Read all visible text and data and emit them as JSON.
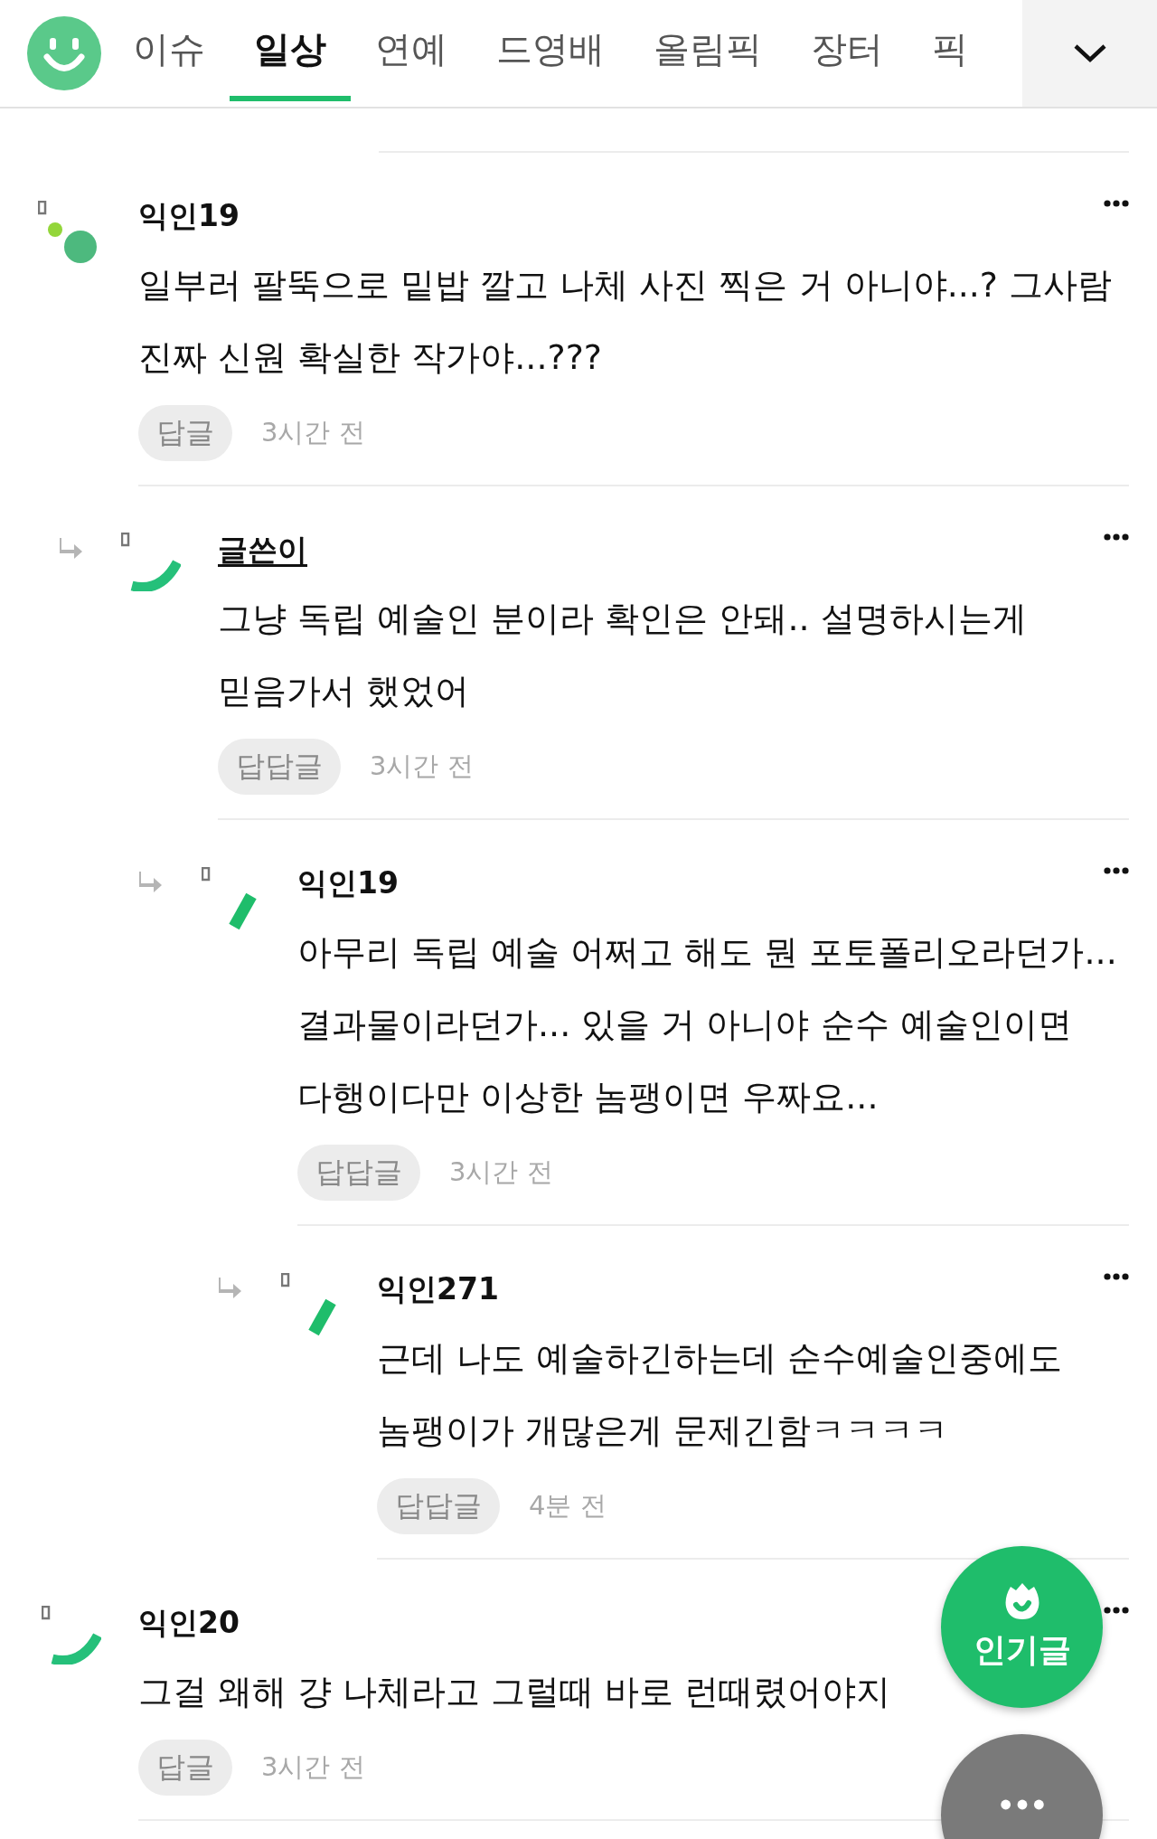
{
  "tabs": [
    {
      "label": "이슈",
      "selected": false
    },
    {
      "label": "일상",
      "selected": true
    },
    {
      "label": "연예",
      "selected": false
    },
    {
      "label": "드영배",
      "selected": false
    },
    {
      "label": "올림픽",
      "selected": false
    },
    {
      "label": "장터",
      "selected": false
    },
    {
      "label": "픽",
      "selected": false
    }
  ],
  "comments": [
    {
      "author": "익인19",
      "is_writer": false,
      "kind": "dots",
      "text": "일부러 팔뚝으로 밑밥 깔고 나체 사진 찍은 거 아니야...? 그사람 진짜 신원 확실한 작가야...???",
      "reply_label": "답글",
      "time": "3시간 전",
      "children": [
        {
          "author": "글쓴이",
          "is_writer": true,
          "kind": "arc",
          "text": "그냥 독립 예술인 분이라 확인은 안돼.. 설명하시는게 믿음가서 했었어",
          "reply_label": "답답글",
          "time": "3시간 전",
          "children": [
            {
              "author": "익인19",
              "is_writer": false,
              "kind": "bar",
              "text": "아무리 독립 예술 어쩌고 해도 뭔 포토폴리오라던가... 결과물이라던가... 있을 거 아니야 순수 예술인이면 다행이다만 이상한 놈팽이면 우짜요...",
              "reply_label": "답답글",
              "time": "3시간 전",
              "children": [
                {
                  "author": "익인271",
                  "is_writer": false,
                  "kind": "bar",
                  "text": "근데 나도 예술하긴하는데 순수예술인중에도 놈팽이가 개많은게 문제긴함ㅋㅋㅋㅋ",
                  "reply_label": "답답글",
                  "time": "4분 전"
                }
              ]
            }
          ]
        }
      ]
    },
    {
      "author": "익인20",
      "is_writer": false,
      "kind": "arc",
      "text": "그걸 왜해 걍 나체라고 그럴때 바로 런때렸어야지",
      "reply_label": "답글",
      "time": "3시간 전"
    }
  ],
  "popular_button": {
    "label": "인기글"
  }
}
